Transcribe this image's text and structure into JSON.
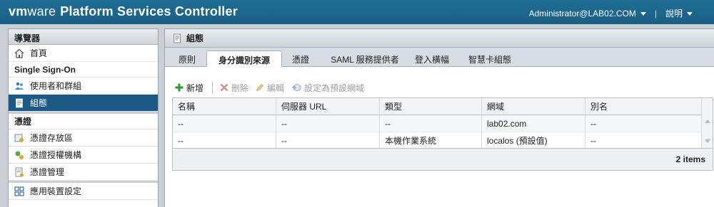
{
  "header": {
    "brand_vm": "vm",
    "brand_ware": "ware",
    "product": "Platform Services Controller",
    "user": "Administrator@LAB02.COM",
    "help": "說明"
  },
  "navigator": {
    "title": "導覽器",
    "home": "首頁",
    "sso_section": "Single Sign-On",
    "users_groups": "使用者和群組",
    "configuration": "組態",
    "certs_section": "憑證",
    "cert_store": "憑證存放區",
    "cert_authority": "憑證授權機構",
    "cert_mgmt": "憑證管理",
    "appliance_settings": "應用裝置設定"
  },
  "panel": {
    "title": "組態",
    "tabs": [
      "原則",
      "身分識別來源",
      "憑證",
      "SAML 服務提供者",
      "登入橫幅",
      "智慧卡組態"
    ],
    "active_tab": "身分識別來源"
  },
  "toolbar": {
    "add": "新增",
    "delete": "刪除",
    "edit": "編輯",
    "set_default": "設定為預設網域"
  },
  "table": {
    "headers": [
      "名稱",
      "伺服器 URL",
      "類型",
      "網域",
      "別名"
    ],
    "rows": [
      [
        "--",
        "--",
        "--",
        "lab02.com",
        "--"
      ],
      [
        "--",
        "--",
        "本機作業系統",
        "localos (預設值)",
        "--"
      ]
    ],
    "footer": "2 items"
  },
  "colors": {
    "header_bg": "#1f6d95",
    "selected_nav": "#1c5a85",
    "add_icon": "#2e9a2e",
    "delete_icon": "#e08a8a"
  }
}
